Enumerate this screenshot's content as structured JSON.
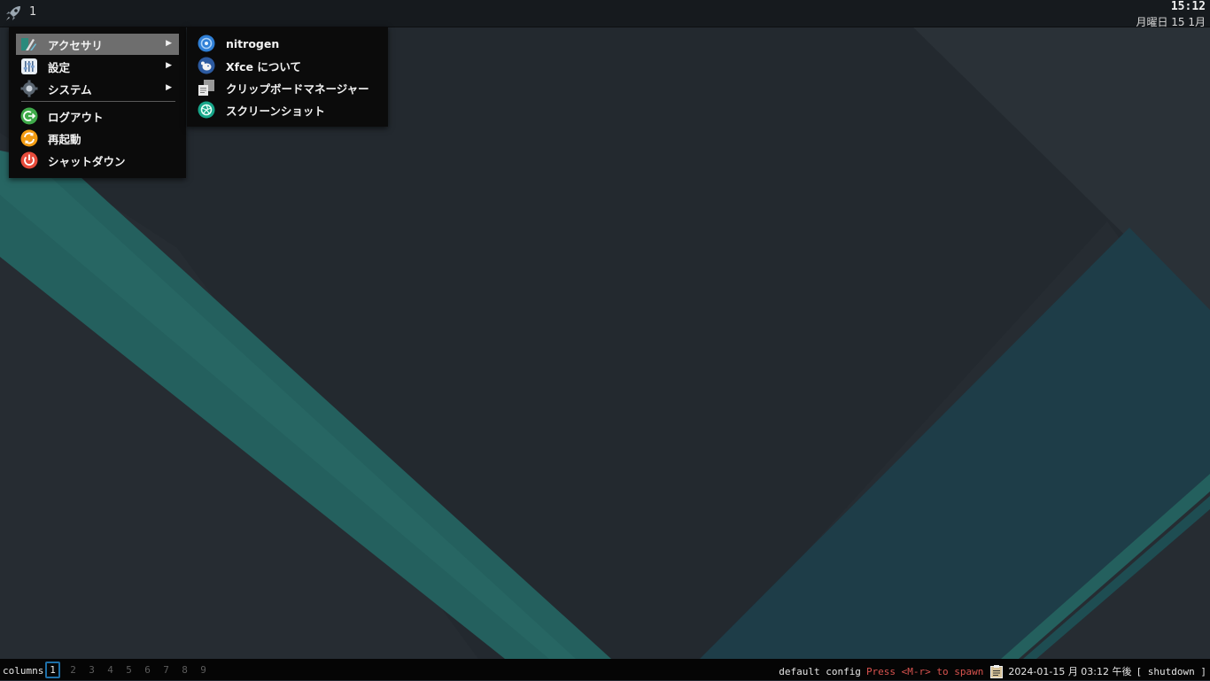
{
  "top_panel": {
    "launcher_icon": "rocket-icon",
    "workspace_label": "1",
    "clock_time": "15:12",
    "clock_date": "月曜日 15 1月"
  },
  "main_menu": {
    "items": [
      {
        "label": "アクセサリ",
        "icon": "accessories-icon",
        "has_submenu": true,
        "active": true
      },
      {
        "label": "設定",
        "icon": "settings-icon",
        "has_submenu": true
      },
      {
        "label": "システム",
        "icon": "system-gear-icon",
        "has_submenu": true
      },
      {
        "label": "ログアウト",
        "icon": "logout-icon"
      },
      {
        "label": "再起動",
        "icon": "restart-icon"
      },
      {
        "label": "シャットダウン",
        "icon": "shutdown-icon"
      }
    ],
    "submenu_arrow": "▶"
  },
  "submenu": {
    "items": [
      {
        "label": "nitrogen",
        "icon": "nitrogen-icon"
      },
      {
        "label": "Xfce について",
        "icon": "xfce-mouse-icon"
      },
      {
        "label": "クリップボードマネージャー",
        "icon": "clipboard-manager-icon"
      },
      {
        "label": "スクリーンショット",
        "icon": "screenshot-icon"
      }
    ]
  },
  "bottom_bar": {
    "layout_name": "columns",
    "workspaces": [
      "1",
      "2",
      "3",
      "4",
      "5",
      "6",
      "7",
      "8",
      "9"
    ],
    "current_workspace": "1",
    "config_text": "default config",
    "hint_text": "Press <M-r> to spawn",
    "clipboard_icon": "clipboard-icon",
    "datetime": "2024-01-15 月 03:12 午後",
    "shutdown_label": "[ shutdown ]"
  },
  "colors": {
    "panel_bg": "#161a1e",
    "menu_bg": "#0b0b0b",
    "active_item_bg": "#6e6e6e",
    "hint_red": "#d9534f",
    "workspace_accent": "#1e6fa8",
    "wallpaper_teal": "#24605e"
  }
}
